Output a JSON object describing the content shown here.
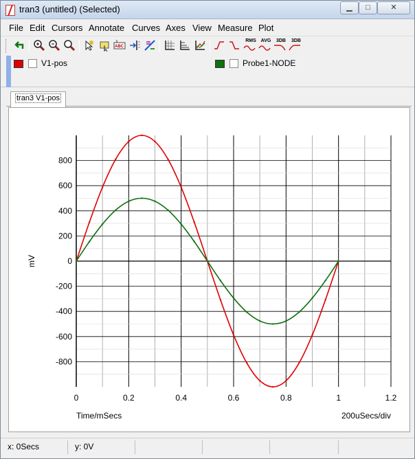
{
  "window": {
    "title": "tran3 (untitled) (Selected)",
    "buttons": {
      "minimize": "▁",
      "maximize": "□",
      "close": "✕"
    }
  },
  "menu": [
    "File",
    "Edit",
    "Cursors",
    "Annotate",
    "Curves",
    "Axes",
    "View",
    "Measure",
    "Plot"
  ],
  "toolbar": {
    "icons": [
      "undo-icon",
      "zoom-in-icon",
      "zoom-out-icon",
      "zoom-fit-icon",
      "cursor-tool-icon",
      "select-tool-icon",
      "annotate-text-icon",
      "add-cursor-icon",
      "curve-edit-icon",
      "axis-grid-icon",
      "axis-log-icon",
      "chart-scale-icon",
      "rise-time-icon",
      "fall-time-icon",
      "rms-icon",
      "avg-icon",
      "3db-high-icon",
      "3db-low-icon"
    ],
    "labels": {
      "rms": "RMS",
      "avg": "AVG",
      "db_high": "3DB",
      "db_low": "3DB"
    }
  },
  "traces": [
    {
      "name": "V1-pos",
      "color": "#e00000",
      "checked": false
    },
    {
      "name": "Probe1-NODE",
      "color": "#107010",
      "checked": false
    }
  ],
  "tabs": [
    {
      "label": "tran3 V1-pos",
      "active": true
    }
  ],
  "chart_data": {
    "type": "line",
    "title": "",
    "xlabel": "Time/mSecs",
    "ylabel": "mV",
    "x_scale_note": "200uSecs/div",
    "xlim": [
      0,
      1.2
    ],
    "ylim": [
      -1000,
      1000
    ],
    "x_ticks": [
      "0",
      "0.2",
      "0.4",
      "0.6",
      "0.8",
      "1",
      "1.2"
    ],
    "y_ticks": [
      "800",
      "600",
      "400",
      "200",
      "0",
      "-200",
      "-400",
      "-600",
      "-800"
    ],
    "grid": true,
    "series": [
      {
        "name": "V1-pos",
        "color": "#e00000",
        "x": [
          0,
          0.05,
          0.1,
          0.15,
          0.2,
          0.25,
          0.3,
          0.35,
          0.4,
          0.45,
          0.5,
          0.55,
          0.6,
          0.65,
          0.7,
          0.75,
          0.8,
          0.85,
          0.9,
          0.95,
          1
        ],
        "values": [
          0,
          309,
          588,
          809,
          951,
          1000,
          951,
          809,
          588,
          309,
          0,
          -309,
          -588,
          -809,
          -951,
          -1000,
          -951,
          -809,
          -588,
          -309,
          0
        ]
      },
      {
        "name": "Probe1-NODE",
        "color": "#107010",
        "x": [
          0,
          0.05,
          0.1,
          0.15,
          0.2,
          0.25,
          0.3,
          0.35,
          0.4,
          0.45,
          0.5,
          0.55,
          0.6,
          0.65,
          0.7,
          0.75,
          0.8,
          0.85,
          0.9,
          0.95,
          1
        ],
        "values": [
          0,
          155,
          294,
          405,
          476,
          500,
          476,
          405,
          294,
          155,
          0,
          -155,
          -294,
          -405,
          -476,
          -500,
          -476,
          -405,
          -294,
          -155,
          0
        ]
      }
    ]
  },
  "status": {
    "x": "x: 0Secs",
    "y": "y: 0V"
  }
}
